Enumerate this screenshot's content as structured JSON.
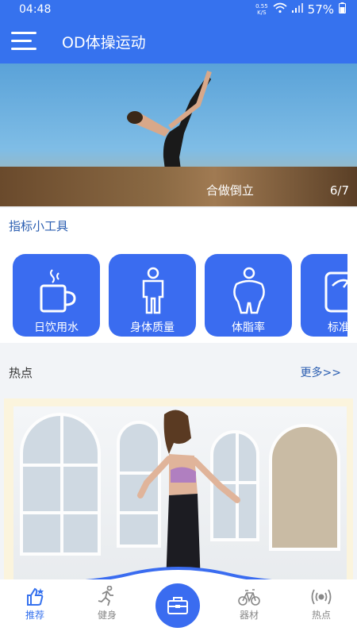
{
  "status": {
    "time": "04:48",
    "speed_value": "0.55",
    "speed_unit": "K/S",
    "battery": "57%"
  },
  "header": {
    "title": "OD体操运动",
    "menu_icon": "hamburger-icon"
  },
  "banner": {
    "caption": "合做倒立",
    "page_indicator": "6/7"
  },
  "tools": {
    "section_title": "指标小工具",
    "items": [
      {
        "label": "日饮用水",
        "icon": "water-cup-icon"
      },
      {
        "label": "身体质量",
        "icon": "person-body-icon"
      },
      {
        "label": "体脂率",
        "icon": "body-fat-icon"
      },
      {
        "label": "标准体",
        "icon": "scale-icon"
      }
    ]
  },
  "hot": {
    "title": "热点",
    "more": "更多>>"
  },
  "nav": {
    "items": [
      {
        "label": "推荐",
        "icon": "thumbs-up-icon",
        "active": true
      },
      {
        "label": "健身",
        "icon": "running-icon",
        "active": false
      },
      {
        "label": "",
        "icon": "toolbox-icon",
        "active": false
      },
      {
        "label": "器材",
        "icon": "bike-icon",
        "active": false
      },
      {
        "label": "热点",
        "icon": "broadcast-icon",
        "active": false
      }
    ]
  },
  "colors": {
    "primary": "#3672ee",
    "tool_bg": "#3a6cf0",
    "section_text": "#2a5db0"
  }
}
